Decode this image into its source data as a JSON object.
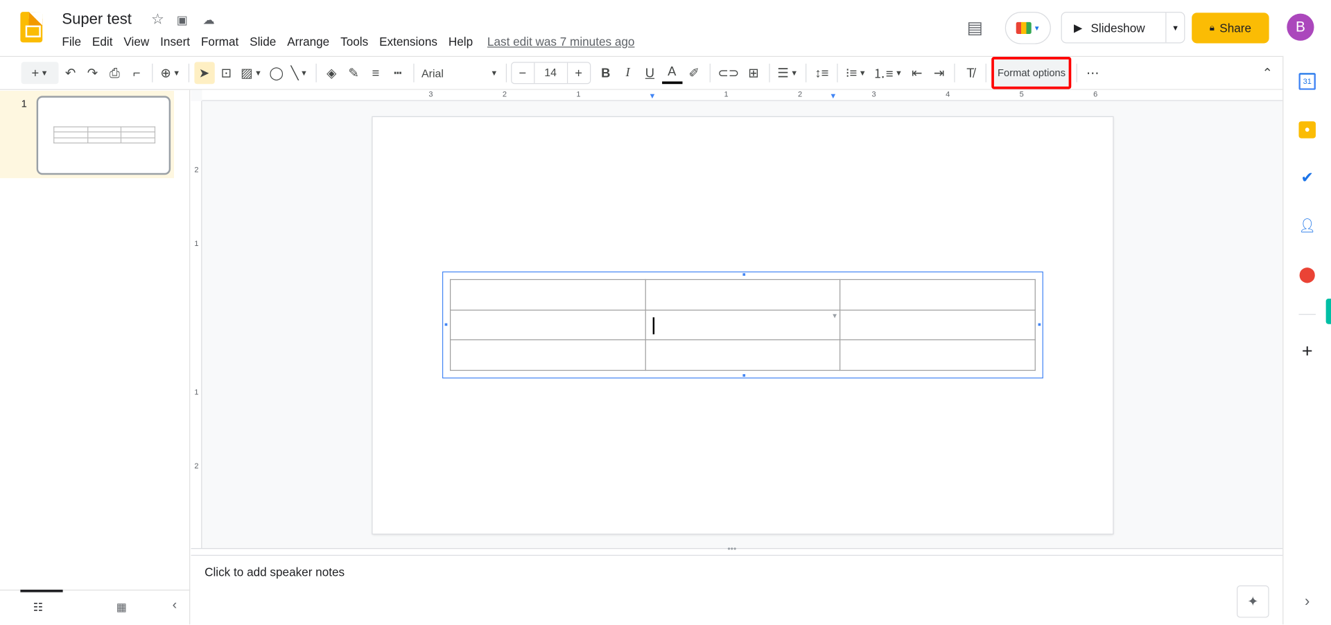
{
  "header": {
    "title": "Super test",
    "menu": [
      "File",
      "Edit",
      "View",
      "Insert",
      "Format",
      "Slide",
      "Arrange",
      "Tools",
      "Extensions",
      "Help"
    ],
    "last_edit": "Last edit was 7 minutes ago",
    "slideshow": "Slideshow",
    "share": "Share",
    "avatar_initial": "B"
  },
  "toolbar": {
    "font": "Arial",
    "font_size": "14",
    "format_options": "Format options"
  },
  "ruler": {
    "top": [
      "3",
      "2",
      "1",
      "1",
      "2",
      "3",
      "4",
      "5",
      "6"
    ],
    "left": [
      "2",
      "1",
      "1",
      "2"
    ]
  },
  "filmstrip": {
    "slide_number": "1"
  },
  "notes": {
    "placeholder": "Click to add speaker notes"
  },
  "colors": {
    "accent": "#fbbc04",
    "selection": "#4285f4",
    "highlight": "#ff0000",
    "avatar": "#ab47bc"
  }
}
